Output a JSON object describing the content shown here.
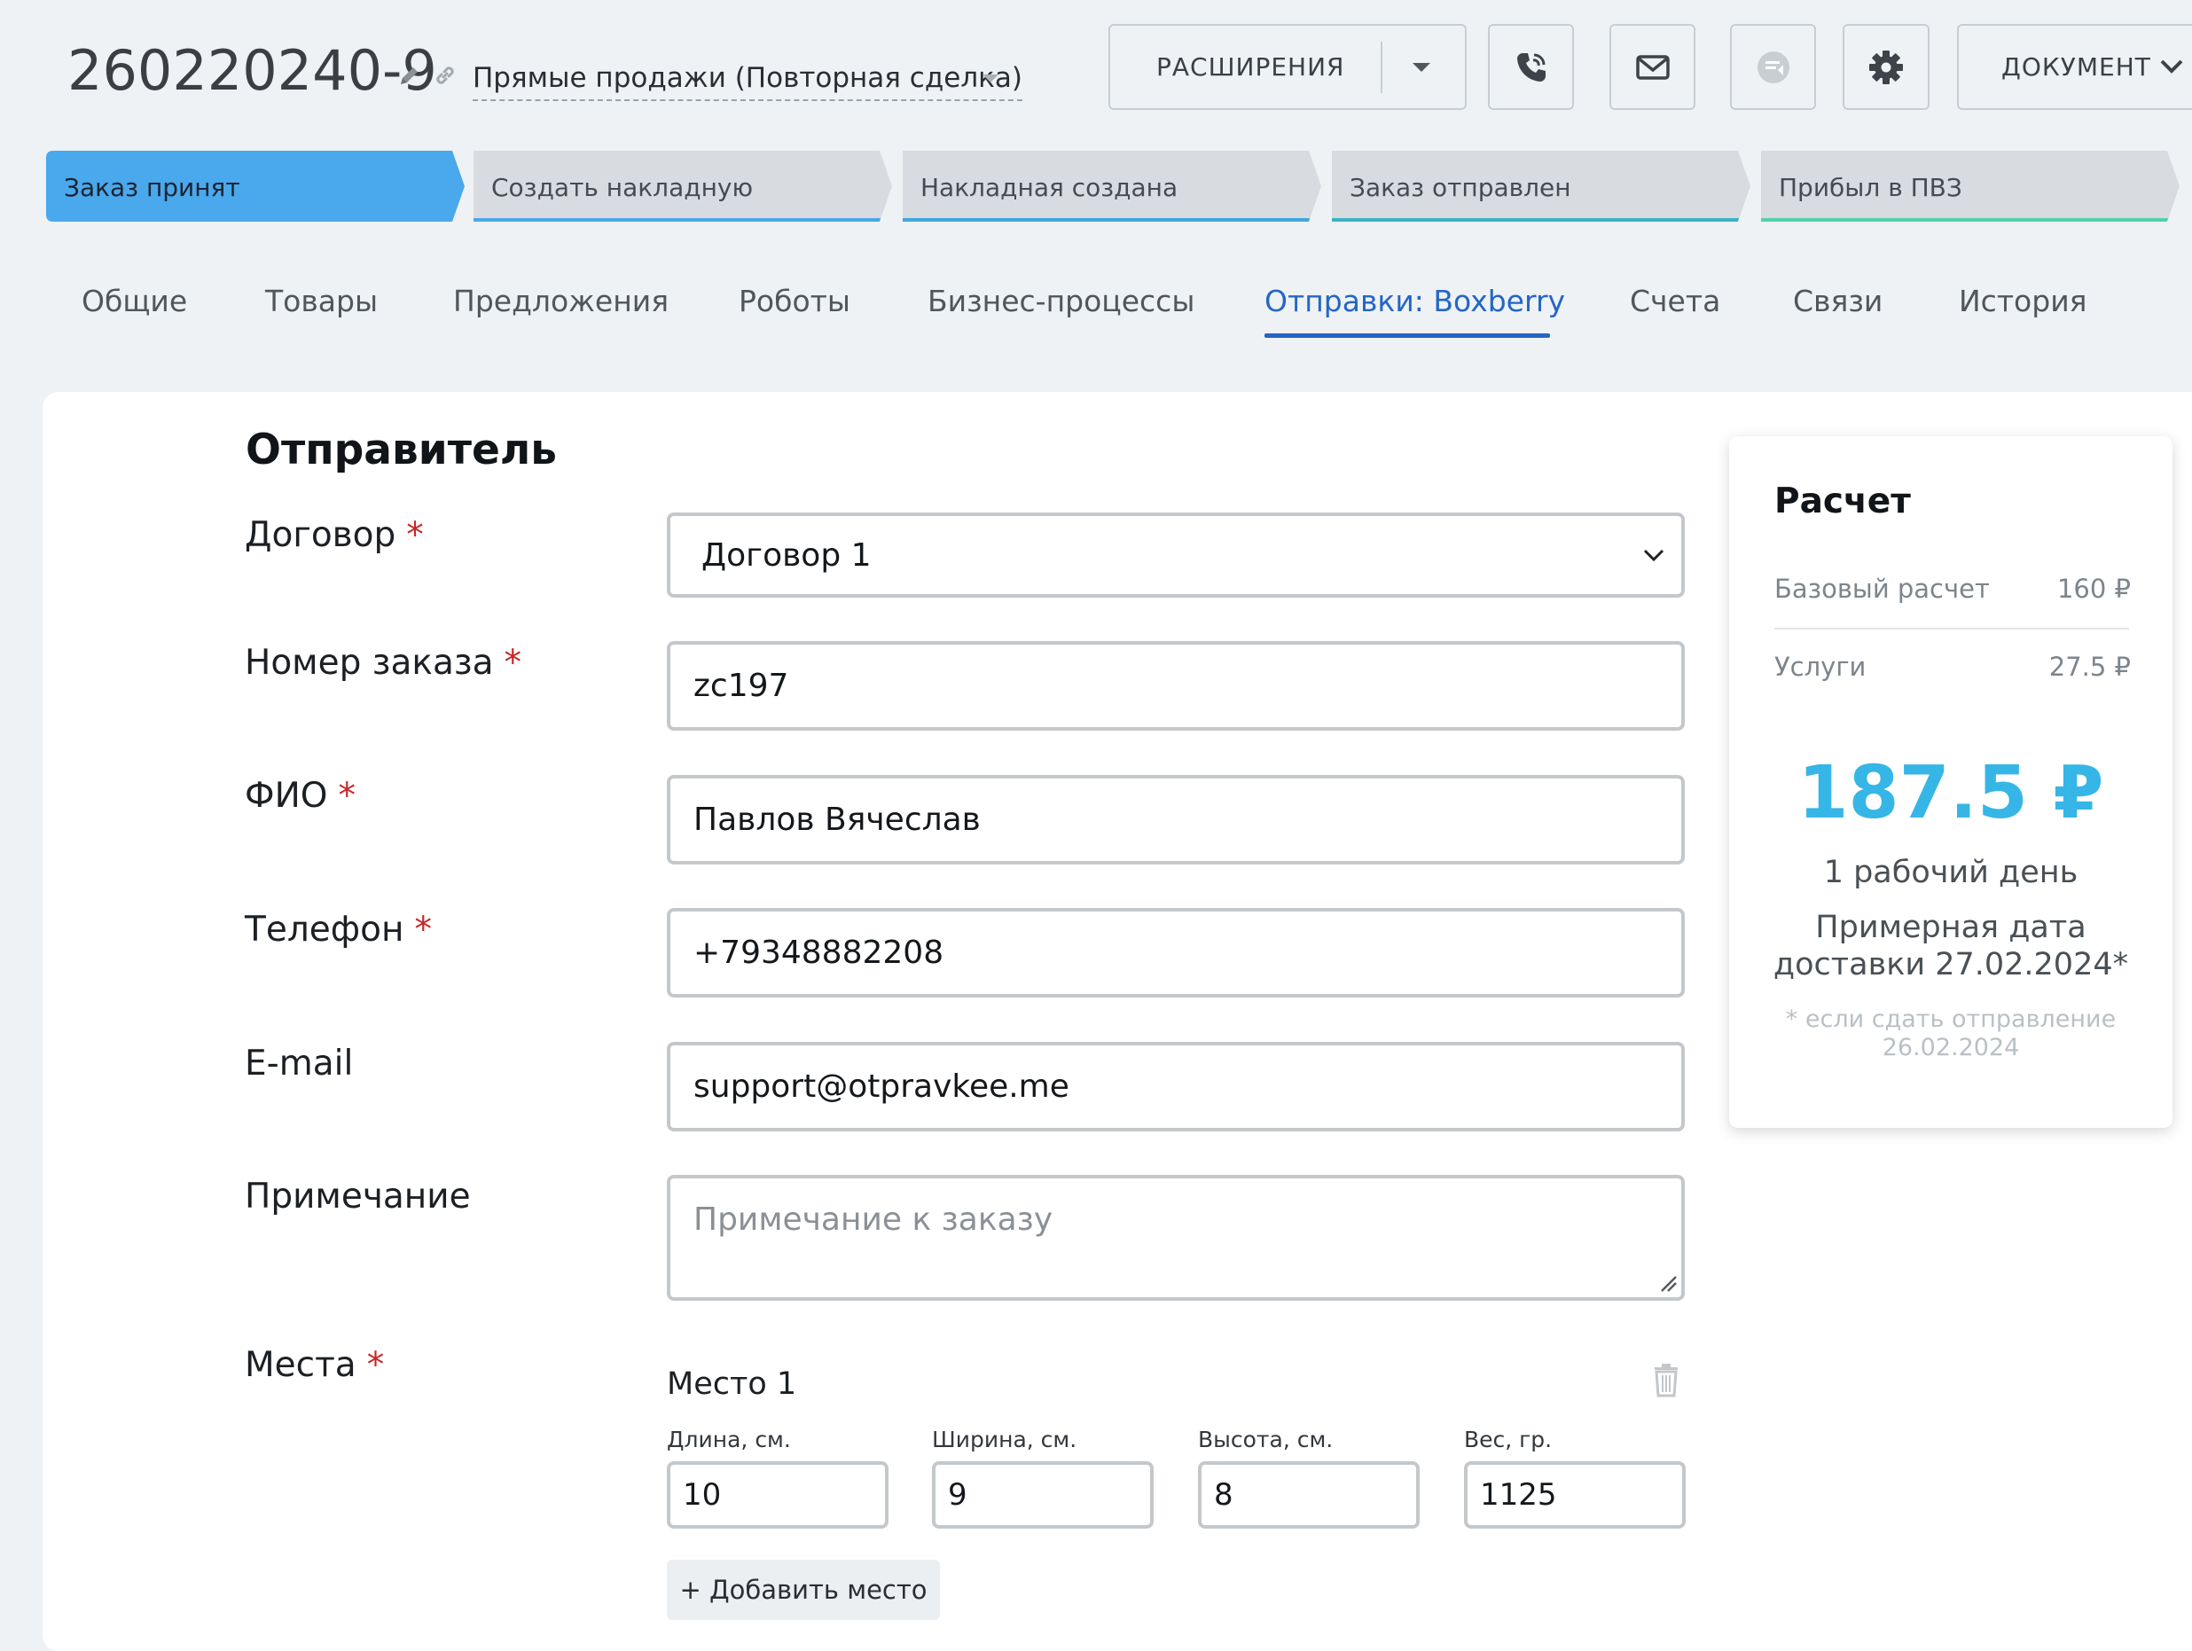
{
  "header": {
    "deal_id": "260220240-9",
    "pipeline": "Прямые продажи (Повторная сделка)",
    "extensions_label": "РАСШИРЕНИЯ",
    "document_label": "ДОКУМЕНТ"
  },
  "stages": [
    {
      "label": "Заказ принят",
      "active": true,
      "color": "#4aa8ec"
    },
    {
      "label": "Создать накладную",
      "active": false,
      "color": "#d8dce0"
    },
    {
      "label": "Накладная создана",
      "active": false,
      "color": "#d8dce0"
    },
    {
      "label": "Заказ отправлен",
      "active": false,
      "color": "#d8dce0"
    },
    {
      "label": "Прибыл в ПВЗ",
      "active": false,
      "color": "#d8dce0"
    }
  ],
  "tabs": [
    {
      "label": "Общие"
    },
    {
      "label": "Товары"
    },
    {
      "label": "Предложения"
    },
    {
      "label": "Роботы"
    },
    {
      "label": "Бизнес-процессы"
    },
    {
      "label": "Отправки: Boxberry",
      "active": true
    },
    {
      "label": "Счета"
    },
    {
      "label": "Связи"
    },
    {
      "label": "История"
    }
  ],
  "form": {
    "section_title": "Отправитель",
    "required_mark": "*",
    "contract": {
      "label": "Договор",
      "value": "Договор 1"
    },
    "order_number": {
      "label": "Номер заказа",
      "value": "zc197"
    },
    "full_name": {
      "label": "ФИО",
      "value": "Павлов Вячеслав"
    },
    "phone": {
      "label": "Телефон",
      "value": "+79348882208"
    },
    "email": {
      "label": "E-mail",
      "value": "support@otpravkee.me"
    },
    "note": {
      "label": "Примечание",
      "placeholder": "Примечание к заказу"
    },
    "places": {
      "label": "Места",
      "items": [
        {
          "title": "Место 1",
          "length_label": "Длина, см.",
          "length": "10",
          "width_label": "Ширина, см.",
          "width": "9",
          "height_label": "Высота, см.",
          "height": "8",
          "weight_label": "Вес, гр.",
          "weight": "1125"
        }
      ],
      "add_label": "+ Добавить место"
    }
  },
  "calc": {
    "title": "Расчет",
    "base_label": "Базовый расчет",
    "base_value": "160 ₽",
    "services_label": "Услуги",
    "services_value": "27.5 ₽",
    "total": "187.5 ₽",
    "days": "1 рабочий день",
    "delivery_date": "Примерная дата доставки 27.02.2024*",
    "footnote": "* если сдать отправление 26.02.2024"
  },
  "colors": {
    "accent": "#2466c6",
    "total": "#36b6e6",
    "required": "#c62828",
    "active_stage": "#4aa8ec"
  }
}
